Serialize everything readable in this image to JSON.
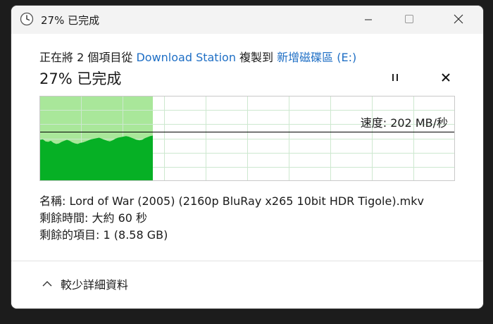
{
  "window": {
    "title": "27% 已完成"
  },
  "copy": {
    "prefix": "正在將 2 個項目從 ",
    "source": "Download Station",
    "middle": " 複製到 ",
    "destination": "新增磁碟區 (E:)"
  },
  "progress": {
    "percent_text": "27% 已完成",
    "fraction": 0.27
  },
  "graph": {
    "speed_text": "速度: 202 MB/秒",
    "fill_color": "#06b025",
    "done_bg_color": "#a9e79a",
    "grid_color": "#cde8cf",
    "speed_samples": [
      78,
      79,
      75,
      74,
      76,
      72,
      70,
      71,
      74,
      76,
      78,
      76,
      73,
      71,
      70,
      72,
      73,
      75,
      77,
      79,
      80,
      81,
      82,
      80,
      78,
      76,
      75,
      77,
      80,
      82,
      83,
      84,
      85,
      84,
      82,
      80,
      78,
      77,
      78,
      81,
      83,
      85,
      86
    ]
  },
  "details": {
    "name_label": "名稱:",
    "name_value": "Lord of War (2005) (2160p BluRay x265 10bit HDR Tigole).mkv",
    "time_label": "剩餘時間:",
    "time_value": "大約 60 秒",
    "items_label": "剩餘的項目:",
    "items_value": "1 (8.58 GB)"
  },
  "footer": {
    "toggle_label": "較少詳細資料"
  },
  "icons": {
    "title": "clock-icon",
    "minimize": "minimize-icon",
    "maximize": "maximize-icon",
    "close": "close-icon",
    "pause": "pause-icon",
    "cancel": "cancel-icon",
    "toggle": "chevron-up-icon"
  }
}
